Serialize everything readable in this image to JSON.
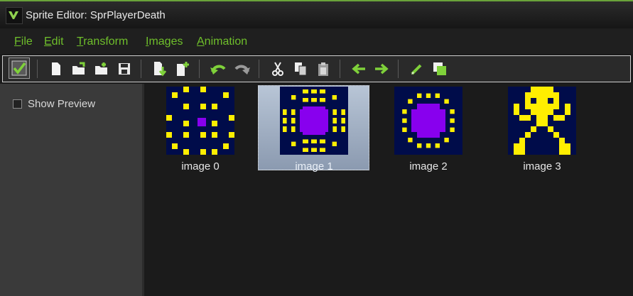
{
  "window": {
    "title": "Sprite Editor: SprPlayerDeath",
    "app_icon": "game-maker-logo-icon"
  },
  "menu": [
    {
      "accel": "F",
      "rest": "ile"
    },
    {
      "accel": "E",
      "rest": "dit"
    },
    {
      "accel": "T",
      "rest": "ransform"
    },
    {
      "accel": "I",
      "rest": "mages"
    },
    {
      "accel": "A",
      "rest": "nimation"
    }
  ],
  "toolbar": {
    "buttons": [
      "confirm-checkmark-icon",
      "new-sprite-icon",
      "open-file-icon",
      "open-folder-icon",
      "save-icon",
      "insert-image-icon",
      "add-image-icon",
      "undo-icon",
      "redo-icon",
      "cut-icon",
      "copy-icon",
      "paste-icon",
      "shift-left-icon",
      "shift-right-icon",
      "edit-pencil-icon",
      "shadow-layer-icon"
    ]
  },
  "sidebar": {
    "show_preview_label": "Show Preview",
    "show_preview_checked": false
  },
  "frames": [
    {
      "label": "image 0",
      "selected": false
    },
    {
      "label": "image 1",
      "selected": true
    },
    {
      "label": "image 2",
      "selected": false
    },
    {
      "label": "image 3",
      "selected": false
    }
  ],
  "colors": {
    "accent": "#6fbf2b",
    "frame_bg": "#000c4a",
    "dot": "#ffee00",
    "core": "#8800ee",
    "selection": "#aab8cc"
  }
}
